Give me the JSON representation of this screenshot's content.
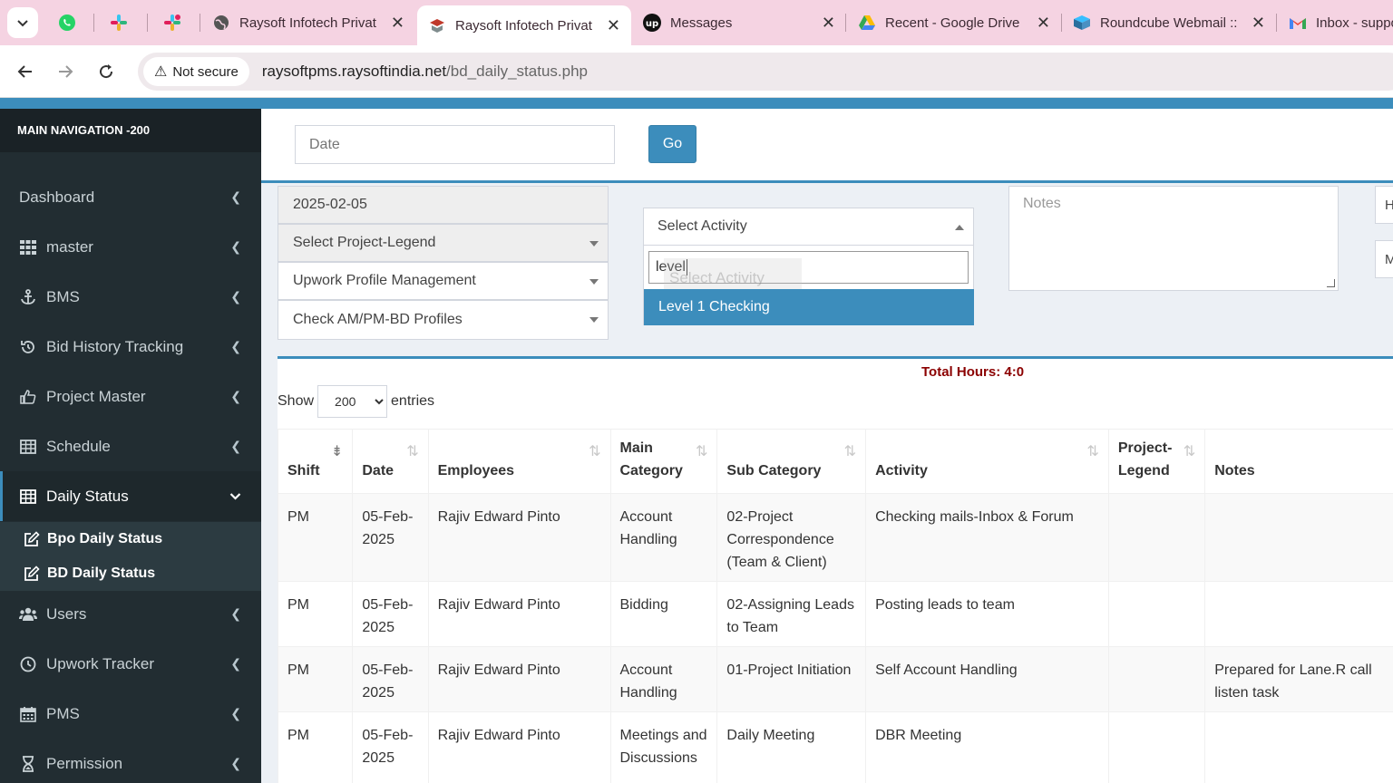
{
  "browser": {
    "tabs": [
      {
        "title": "Raysoft Infotech Privat",
        "icon": "globe-icon"
      },
      {
        "title": "Raysoft Infotech Privat",
        "icon": "raysoft-logo-icon",
        "active": true
      },
      {
        "title": "Messages",
        "icon": "upwork-icon"
      },
      {
        "title": "Recent - Google Drive",
        "icon": "google-drive-icon"
      },
      {
        "title": "Roundcube Webmail ::",
        "icon": "roundcube-icon"
      },
      {
        "title": "Inbox - suppo",
        "icon": "gmail-icon"
      }
    ],
    "pinned_tabs": [
      "whatsapp-icon",
      "slack-icon",
      "slack-icon"
    ],
    "security_label": "Not secure",
    "url_host": "raysoftpms.raysoftindia.net",
    "url_path": "/bd_daily_status.php"
  },
  "sidebar": {
    "header": "MAIN NAVIGATION -200",
    "items": [
      {
        "label": "Dashboard",
        "icon": "dashboard-icon"
      },
      {
        "label": "master",
        "icon": "grid-icon"
      },
      {
        "label": "BMS",
        "icon": "anchor-icon"
      },
      {
        "label": "Bid History Tracking",
        "icon": "history-icon"
      },
      {
        "label": "Project Master",
        "icon": "thumbs-up-icon"
      },
      {
        "label": "Schedule",
        "icon": "table-icon"
      },
      {
        "label": "Daily Status",
        "icon": "table-icon",
        "active": true
      },
      {
        "label": "Users",
        "icon": "users-icon"
      },
      {
        "label": "Upwork Tracker",
        "icon": "clock-icon"
      },
      {
        "label": "PMS",
        "icon": "calendar-icon"
      },
      {
        "label": "Permission",
        "icon": "hourglass-icon"
      }
    ],
    "subitems": [
      {
        "label": "Bpo Daily Status",
        "icon": "edit-icon"
      },
      {
        "label": "BD Daily Status",
        "icon": "edit-icon"
      }
    ]
  },
  "filter": {
    "date_placeholder": "Date",
    "go_label": "Go"
  },
  "form": {
    "date_value": "2025-02-05",
    "project_legend": "Select Project-Legend",
    "main_category": "Upwork Profile Management",
    "sub_category": "Check AM/PM-BD Profiles",
    "activity_placeholder": "Select Activity",
    "activity_search": "level",
    "activity_ghost": "Select Activity",
    "activity_option": "Level 1 Checking",
    "notes_placeholder": "Notes",
    "side_field_1": "H",
    "side_field_2": "M"
  },
  "table": {
    "total_hours": "Total Hours: 4:0",
    "show_label": "Show",
    "entries_label": "entries",
    "page_size": "200",
    "headers": [
      "Shift",
      "Date",
      "Employees",
      "Main Category",
      "Sub Category",
      "Activity",
      "Project-Legend",
      "Notes"
    ],
    "rows": [
      [
        "PM",
        "05-Feb-2025",
        "Rajiv Edward Pinto",
        "Account Handling",
        "02-Project Correspondence (Team & Client)",
        "Checking mails-Inbox & Forum",
        "",
        ""
      ],
      [
        "PM",
        "05-Feb-2025",
        "Rajiv Edward Pinto",
        "Bidding",
        "02-Assigning Leads to Team",
        "Posting leads to team",
        "",
        ""
      ],
      [
        "PM",
        "05-Feb-2025",
        "Rajiv Edward Pinto",
        "Account Handling",
        "01-Project Initiation",
        "Self Account Handling",
        "",
        "Prepared for Lane.R call listen task"
      ],
      [
        "PM",
        "05-Feb-2025",
        "Rajiv Edward Pinto",
        "Meetings and Discussions",
        "Daily Meeting",
        "DBR Meeting",
        "",
        ""
      ]
    ]
  },
  "colors": {
    "primary": "#3c8dbc",
    "sidebar_bg": "#222d32",
    "total_hours": "#8b0000",
    "tabbar": "#f5d3e2"
  }
}
